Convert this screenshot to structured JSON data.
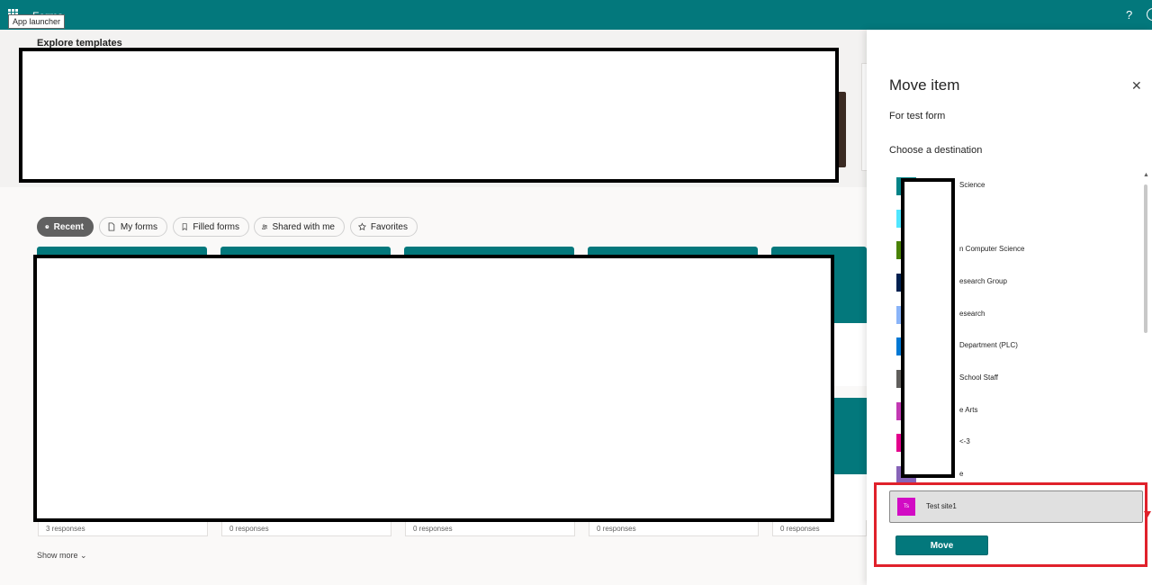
{
  "header": {
    "app_name": "Forms",
    "tooltip": "App launcher",
    "help_glyph": "?"
  },
  "templates": {
    "title": "Explore templates"
  },
  "filters": [
    {
      "label": "Recent",
      "icon": "clock-icon",
      "active": true
    },
    {
      "label": "My forms",
      "icon": "document-icon",
      "active": false
    },
    {
      "label": "Filled forms",
      "icon": "bookmark-icon",
      "active": false
    },
    {
      "label": "Shared with me",
      "icon": "people-icon",
      "active": false
    },
    {
      "label": "Favorites",
      "icon": "star-icon",
      "active": false
    }
  ],
  "cards": [
    {
      "responses": "3 responses"
    },
    {
      "responses": "0 responses"
    },
    {
      "responses": "0 responses"
    },
    {
      "responses": "0 responses"
    },
    {
      "responses": "0 responses"
    }
  ],
  "show_more": "Show more",
  "panel": {
    "title": "Move item",
    "subtitle": "For test form",
    "choose_label": "Choose a destination",
    "destinations": [
      {
        "label": "Science",
        "color": "#038387"
      },
      {
        "label": "",
        "color": "#50e6ff"
      },
      {
        "label": "n Computer Science",
        "color": "#498205"
      },
      {
        "label": "esearch Group",
        "color": "#002050"
      },
      {
        "label": "esearch",
        "color": "#8ab4f8"
      },
      {
        "label": "Department (PLC)",
        "color": "#0078d4"
      },
      {
        "label": "School Staff",
        "color": "#605e5c"
      },
      {
        "label": "e Arts",
        "color": "#c239b3"
      },
      {
        "label": "<-3",
        "color": "#e3008c"
      },
      {
        "label": "e",
        "color": "#8764b8"
      }
    ],
    "selected": {
      "avatar_text": "Ts",
      "label": "Test site1",
      "color": "#d20bc4"
    },
    "move_label": "Move",
    "close_glyph": "✕"
  }
}
